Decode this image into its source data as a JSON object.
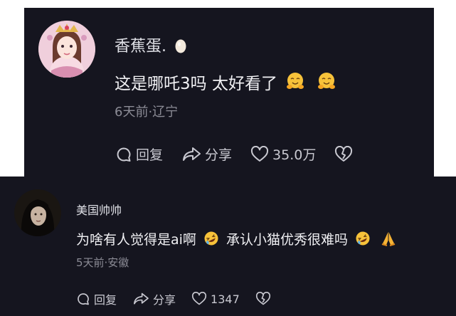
{
  "comments": [
    {
      "username": "香蕉蛋.",
      "text_part1": "这是哪吒3吗 太好看了",
      "meta": "6天前·辽宁",
      "reply_label": "回复",
      "share_label": "分享",
      "likes": "35.0万"
    },
    {
      "username": "美国帅帅",
      "text_part1": "为啥有人觉得是ai啊",
      "text_part2": "承认小猫优秀很难吗",
      "meta": "5天前·安徽",
      "reply_label": "回复",
      "share_label": "分享",
      "likes": "1347"
    }
  ],
  "icons": {
    "username_badge": "egg-icon",
    "emoji_1": "hugging-face-icon",
    "emoji_2": "rolling-laughing-icon",
    "emoji_3": "folded-hands-icon",
    "reply": "chat-bubble-icon",
    "share": "share-arrow-icon",
    "like": "heart-icon",
    "dislike": "broken-heart-icon"
  },
  "colors": {
    "card_background": "#15151f",
    "primary_text": "#f1f1f4",
    "secondary_text": "#8c8c96",
    "action_text": "#c9c9d1"
  }
}
